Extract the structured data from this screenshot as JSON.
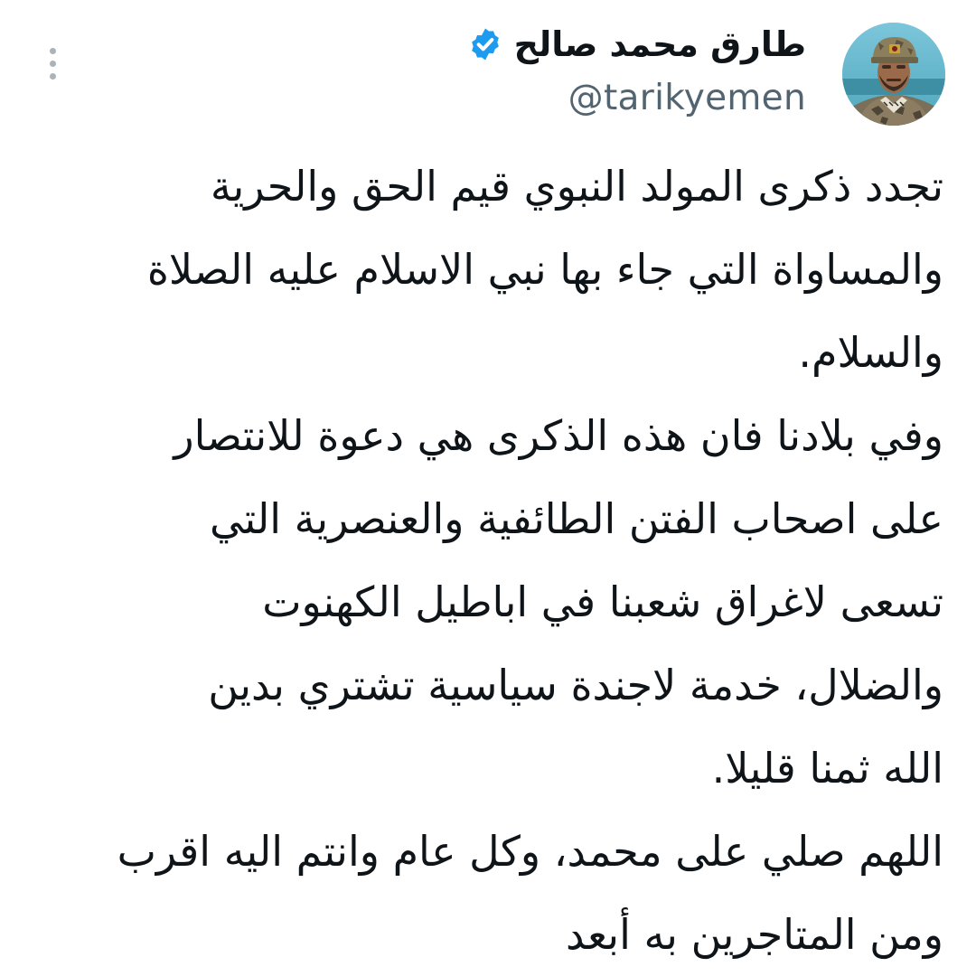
{
  "tweet": {
    "author": {
      "display_name": "طارق محمد صالح",
      "handle": "@tarikyemen",
      "verified_icon": "verified-badge-icon",
      "avatar_icon": "profile-avatar"
    },
    "more_icon": "vertical-ellipsis-icon",
    "body_lines": [
      "تجدد ذكرى المولد النبوي قيم الحق والحرية",
      "والمساواة التي جاء بها نبي الاسلام عليه الصلاة",
      "والسلام.",
      "وفي بلادنا فان هذه الذكرى هي دعوة للانتصار",
      "على اصحاب الفتن الطائفية والعنصرية التي",
      "تسعى لاغراق شعبنا في اباطيل الكهنوت",
      "والضلال، خدمة لاجندة سياسية تشتري بدين",
      "الله ثمنا قليلا.",
      "اللهم صلي على محمد، وكل عام وانتم اليه اقرب",
      "ومن المتاجرين به أبعد"
    ]
  },
  "colors": {
    "text": "#0f1419",
    "secondary": "#536471",
    "verified": "#1d9bf0",
    "more_dots": "#a8b3bc",
    "background": "#ffffff"
  }
}
